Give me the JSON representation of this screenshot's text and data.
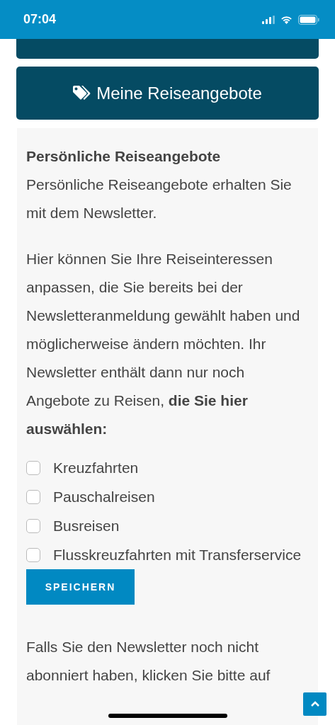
{
  "status_bar": {
    "time": "07:04"
  },
  "menu_buttons": [
    {
      "kind": "partial"
    },
    {
      "kind": "tag",
      "label": "Meine Reiseangebote"
    }
  ],
  "section": {
    "title": "Persönliche Reiseangebote",
    "intro": "Persönliche Reiseangebote erhalten Sie mit dem Newsletter.",
    "body": "Hier können Sie Ihre Reiseinteressen anpassen, die Sie bereits bei der Newsletteranmeldung gewählt haben und möglicherweise ändern möchten. Ihr Newsletter enthält dann nur noch Angebote zu Reisen, **die Sie hier auswählen:**",
    "options": [
      {
        "label": "Kreuzfahrten",
        "checked": false
      },
      {
        "label": "Pauschalreisen",
        "checked": false
      },
      {
        "label": "Busreisen",
        "checked": false
      },
      {
        "label": "Flusskreuzfahrten mit Transferservice",
        "checked": false
      }
    ],
    "save_button": "SPEICHERN",
    "footer_text": "Falls Sie den Newsletter noch nicht abonniert haben, klicken Sie bitte auf"
  }
}
